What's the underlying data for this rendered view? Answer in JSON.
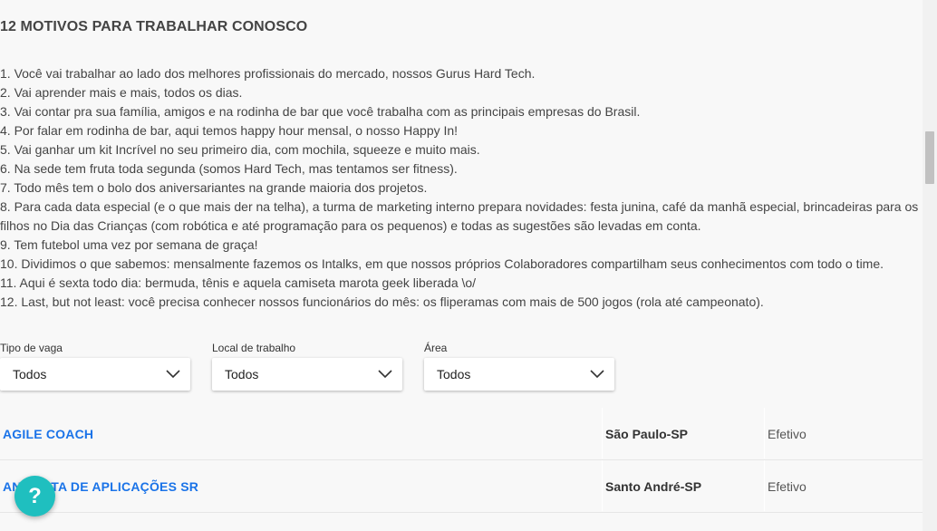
{
  "section": {
    "title": "12 MOTIVOS PARA TRABALHAR CONOSCO"
  },
  "motivos": [
    "1. Você vai trabalhar ao lado dos melhores profissionais do mercado, nossos Gurus Hard Tech.",
    "2. Vai aprender mais e mais, todos os dias.",
    "3. Vai contar pra sua família, amigos e na rodinha de bar que você trabalha com as principais empresas do Brasil.",
    "4. Por falar em rodinha de bar, aqui temos happy hour mensal, o nosso Happy In!",
    "5. Vai ganhar um kit Incrível no seu primeiro dia, com mochila, squeeze e muito mais.",
    "6. Na sede tem fruta toda segunda (somos Hard Tech, mas tentamos ser fitness).",
    "7. Todo mês tem o bolo dos aniversariantes na grande maioria dos projetos.",
    "8. Para cada data especial (e o que mais der na telha), a turma de marketing interno prepara novidades: festa junina, café da manhã especial, brincadeiras para os filhos no Dia das Crianças (com robótica e até programação para os pequenos) e todas as sugestões são levadas em conta.",
    "9. Tem futebol uma vez por semana de graça!",
    "10. Dividimos o que sabemos: mensalmente fazemos os Intalks, em que nossos próprios Colaboradores compartilham seus conhecimentos com todo o time.",
    "11. Aqui é sexta todo dia: bermuda, tênis e aquela camiseta marota geek liberada \\o/",
    "12. Last, but not least: você precisa conhecer nossos funcionários do mês: os fliperamas com mais de 500 jogos (rola até campeonato)."
  ],
  "filters": {
    "tipo": {
      "label": "Tipo de vaga",
      "value": "Todos"
    },
    "local": {
      "label": "Local de trabalho",
      "value": "Todos"
    },
    "area": {
      "label": "Área",
      "value": "Todos"
    }
  },
  "jobs": [
    {
      "title": "AGILE COACH",
      "location": "São Paulo-SP",
      "type": "Efetivo"
    },
    {
      "title": "ANALISTA DE APLICAÇÕES SR",
      "location": "Santo André-SP",
      "type": "Efetivo"
    }
  ],
  "help": {
    "label": "?"
  },
  "colors": {
    "link": "#1a73e8",
    "help_button": "#1fbfbf",
    "background": "#f8f8f8"
  },
  "icons": {
    "select_arrow": "chevron-down-icon",
    "help": "question-mark-icon"
  }
}
